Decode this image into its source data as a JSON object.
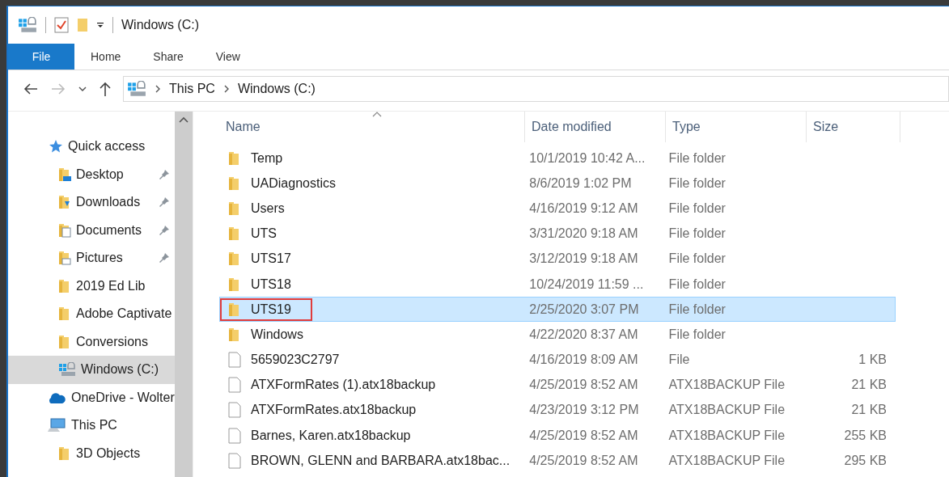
{
  "title_bar": {
    "title": "Windows (C:)"
  },
  "ribbon": {
    "tabs": [
      {
        "label": "File",
        "selected": true
      },
      {
        "label": "Home",
        "selected": false
      },
      {
        "label": "Share",
        "selected": false
      },
      {
        "label": "View",
        "selected": false
      }
    ]
  },
  "address_bar": {
    "breadcrumbs": [
      "This PC",
      "Windows (C:)"
    ]
  },
  "navigation": {
    "items": [
      {
        "label": "Quick access",
        "kind": "star",
        "selected": false,
        "children": [
          {
            "label": "Desktop",
            "kind": "desktop",
            "pinned": true,
            "selected": false
          },
          {
            "label": "Downloads",
            "kind": "downloads",
            "pinned": true,
            "selected": false
          },
          {
            "label": "Documents",
            "kind": "documents",
            "pinned": true,
            "selected": false
          },
          {
            "label": "Pictures",
            "kind": "pictures",
            "pinned": true,
            "selected": false
          },
          {
            "label": "2019 Ed Lib",
            "kind": "folder",
            "pinned": false,
            "selected": false
          },
          {
            "label": "Adobe Captivate",
            "kind": "folder",
            "pinned": false,
            "selected": false
          },
          {
            "label": "Conversions",
            "kind": "folder",
            "pinned": false,
            "selected": false
          },
          {
            "label": "Windows (C:)",
            "kind": "drive",
            "pinned": false,
            "selected": true
          }
        ]
      },
      {
        "label": "OneDrive - Wolter",
        "kind": "cloud",
        "selected": false
      },
      {
        "label": "This PC",
        "kind": "pc",
        "selected": false,
        "children": [
          {
            "label": "3D Objects",
            "kind": "folder",
            "pinned": false,
            "selected": false
          }
        ]
      }
    ]
  },
  "file_list": {
    "columns": [
      {
        "label": "Name",
        "sorted": true
      },
      {
        "label": "Date modified",
        "sorted": false
      },
      {
        "label": "Type",
        "sorted": false
      },
      {
        "label": "Size",
        "sorted": false
      }
    ],
    "rows": [
      {
        "name": "Temp",
        "date": "10/1/2019 10:42 A...",
        "type": "File folder",
        "size": "",
        "kind": "folder",
        "selected": false,
        "outlined": false
      },
      {
        "name": "UADiagnostics",
        "date": "8/6/2019 1:02 PM",
        "type": "File folder",
        "size": "",
        "kind": "folder",
        "selected": false,
        "outlined": false
      },
      {
        "name": "Users",
        "date": "4/16/2019 9:12 AM",
        "type": "File folder",
        "size": "",
        "kind": "folder",
        "selected": false,
        "outlined": false
      },
      {
        "name": "UTS",
        "date": "3/31/2020 9:18 AM",
        "type": "File folder",
        "size": "",
        "kind": "folder",
        "selected": false,
        "outlined": false
      },
      {
        "name": "UTS17",
        "date": "3/12/2019 9:18 AM",
        "type": "File folder",
        "size": "",
        "kind": "folder",
        "selected": false,
        "outlined": false
      },
      {
        "name": "UTS18",
        "date": "10/24/2019 11:59 ...",
        "type": "File folder",
        "size": "",
        "kind": "folder",
        "selected": false,
        "outlined": false
      },
      {
        "name": "UTS19",
        "date": "2/25/2020 3:07 PM",
        "type": "File folder",
        "size": "",
        "kind": "folder",
        "selected": true,
        "outlined": true
      },
      {
        "name": "Windows",
        "date": "4/22/2020 8:37 AM",
        "type": "File folder",
        "size": "",
        "kind": "folder",
        "selected": false,
        "outlined": false
      },
      {
        "name": "5659023C2797",
        "date": "4/16/2019 8:09 AM",
        "type": "File",
        "size": "1 KB",
        "kind": "file",
        "selected": false,
        "outlined": false
      },
      {
        "name": "ATXFormRates (1).atx18backup",
        "date": "4/25/2019 8:52 AM",
        "type": "ATX18BACKUP File",
        "size": "21 KB",
        "kind": "file",
        "selected": false,
        "outlined": false
      },
      {
        "name": "ATXFormRates.atx18backup",
        "date": "4/23/2019 3:12 PM",
        "type": "ATX18BACKUP File",
        "size": "21 KB",
        "kind": "file",
        "selected": false,
        "outlined": false
      },
      {
        "name": "Barnes, Karen.atx18backup",
        "date": "4/25/2019 8:52 AM",
        "type": "ATX18BACKUP File",
        "size": "255 KB",
        "kind": "file",
        "selected": false,
        "outlined": false
      },
      {
        "name": "BROWN, GLENN and BARBARA.atx18bac...",
        "date": "4/25/2019 8:52 AM",
        "type": "ATX18BACKUP File",
        "size": "295 KB",
        "kind": "file",
        "selected": false,
        "outlined": false
      }
    ]
  }
}
